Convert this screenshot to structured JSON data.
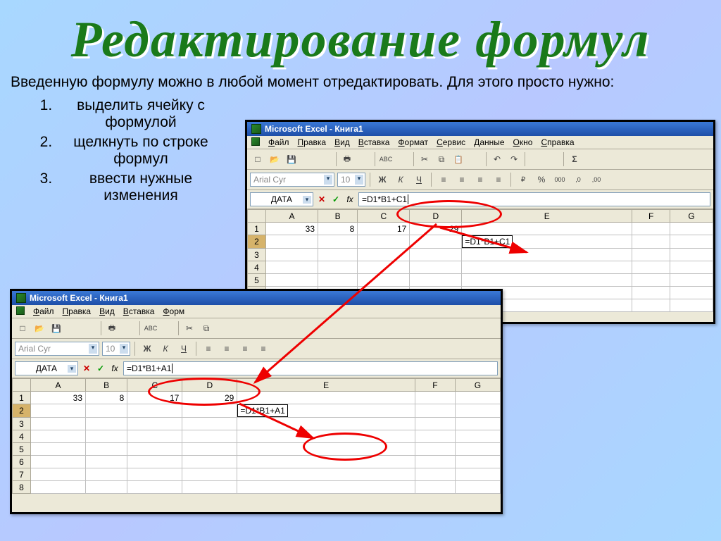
{
  "title": "Редактирование формул",
  "intro": "Введенную формулу можно в любой момент отредактировать. Для этого просто нужно:",
  "steps": [
    "выделить ячейку с формулой",
    "щелкнуть по строке формул",
    "ввести нужные изменения"
  ],
  "win_title": "Microsoft Excel - Книга1",
  "menus": [
    "Файл",
    "Правка",
    "Вид",
    "Вставка",
    "Формат",
    "Сервис",
    "Данные",
    "Окно",
    "Справка"
  ],
  "menus_short": [
    "Файл",
    "Правка",
    "Вид",
    "Вставка",
    "Форм"
  ],
  "font_name": "Arial Cyr",
  "font_size": "10",
  "namebox": "ДАТА",
  "fx_cancel": "✕",
  "fx_ok": "✓",
  "fx_label": "fx",
  "formula_top": "=D1*B1+C1",
  "formula_bottom": "=D1*B1+A1",
  "cols": [
    "A",
    "B",
    "C",
    "D",
    "E",
    "F",
    "G"
  ],
  "row1": [
    "33",
    "8",
    "17",
    "29"
  ],
  "cell_display_top": "=D1*B1+C1",
  "cell_display_bottom": "=D1*B1+A1"
}
